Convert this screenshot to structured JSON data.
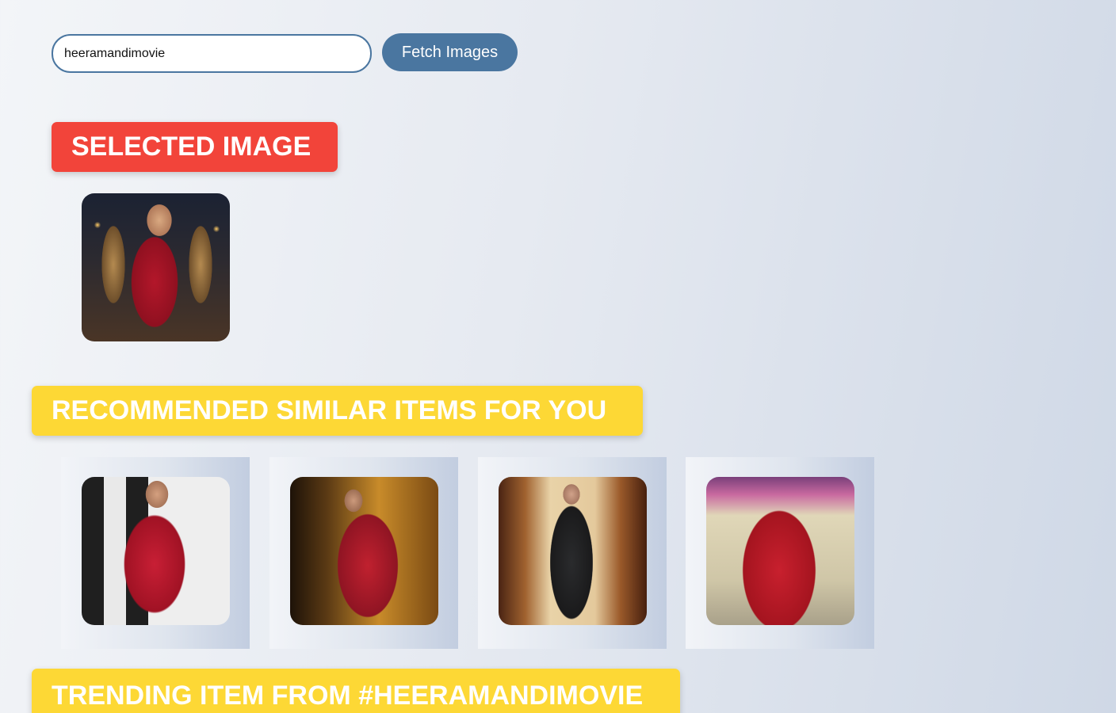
{
  "search": {
    "value": "heeramandimovie",
    "button_label": "Fetch Images"
  },
  "sections": {
    "selected_title": "SELECTED IMAGE",
    "recommended_title": "RECOMMENDED SIMILAR ITEMS FOR YOU",
    "trending_title": "TRENDING ITEM FROM #HEERAMANDIMOVIE"
  },
  "colors": {
    "accent_blue": "#4a76a0",
    "selected_banner": "#f2443a",
    "recommended_banner": "#fdd835",
    "banner_text": "#ffffff"
  }
}
